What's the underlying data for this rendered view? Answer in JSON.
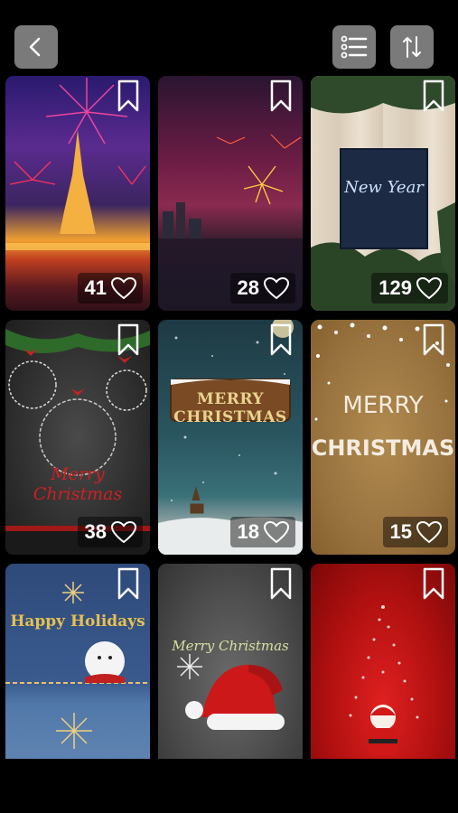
{
  "toolbar": {
    "back_icon": "chevron-left-icon",
    "list_icon": "list-icon",
    "sort_icon": "sort-arrows-icon",
    "button_color": "#7a7a7a"
  },
  "cards": [
    {
      "likes": "41",
      "theme": "fireworks-temple"
    },
    {
      "likes": "28",
      "theme": "fireworks-city"
    },
    {
      "likes": "129",
      "theme": "new-year-card",
      "art_title": "New Year"
    },
    {
      "likes": "38",
      "theme": "ornaments",
      "art_title": "Merry Christmas"
    },
    {
      "likes": "18",
      "theme": "wooden-sign",
      "art_title": "MERRY CHRISTMAS"
    },
    {
      "likes": "15",
      "theme": "kraft-paper",
      "art_title_1": "MERRY",
      "art_title_2": "CHRISTMAS"
    },
    {
      "theme": "denim-holidays",
      "art_title": "Happy Holidays"
    },
    {
      "theme": "santa-hat",
      "art_title": "Merry Christmas"
    },
    {
      "theme": "red-tree-santa"
    }
  ]
}
